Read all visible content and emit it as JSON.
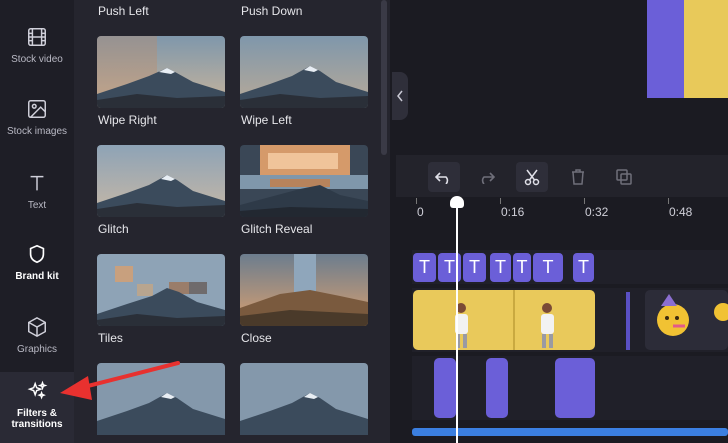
{
  "rail": {
    "items": [
      {
        "label": "Stock video",
        "icon": "film-icon"
      },
      {
        "label": "Stock images",
        "icon": "image-icon"
      },
      {
        "label": "Text",
        "icon": "text-icon"
      },
      {
        "label": "Brand kit",
        "icon": "shield-icon"
      },
      {
        "label": "Graphics",
        "icon": "cube-icon"
      },
      {
        "label": "Filters & transitions",
        "icon": "sparkles-icon"
      }
    ]
  },
  "transitions": {
    "top_labels": [
      "Push Left",
      "Push Down"
    ],
    "tiles": [
      {
        "label": "Wipe Right"
      },
      {
        "label": "Wipe Left"
      },
      {
        "label": "Glitch"
      },
      {
        "label": "Glitch Reveal"
      },
      {
        "label": "Tiles"
      },
      {
        "label": "Close"
      }
    ]
  },
  "timeline": {
    "ticks": [
      "0",
      "0:16",
      "0:32",
      "0:48"
    ],
    "text_clip_glyph": "T"
  },
  "colors": {
    "accent": "#6b5fd8",
    "arrow": "#e8312f",
    "progress": "#3b7fe0"
  }
}
